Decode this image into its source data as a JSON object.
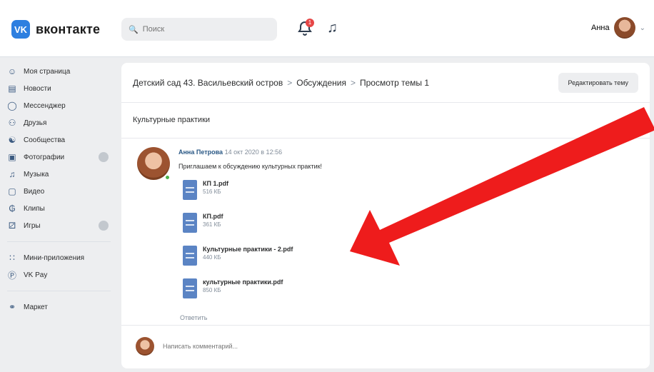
{
  "header": {
    "logo_text": "вконтакте",
    "search_placeholder": "Поиск",
    "notifications_badge": "1",
    "user_name": "Анна"
  },
  "sidebar": {
    "items": [
      {
        "label": "Моя страница",
        "icon": "user-circle-icon"
      },
      {
        "label": "Новости",
        "icon": "news-icon"
      },
      {
        "label": "Мессенджер",
        "icon": "chat-icon"
      },
      {
        "label": "Друзья",
        "icon": "friends-icon"
      },
      {
        "label": "Сообщества",
        "icon": "communities-icon"
      },
      {
        "label": "Фотографии",
        "icon": "photo-icon"
      },
      {
        "label": "Музыка",
        "icon": "music-icon"
      },
      {
        "label": "Видео",
        "icon": "video-icon"
      },
      {
        "label": "Клипы",
        "icon": "clips-icon"
      },
      {
        "label": "Игры",
        "icon": "games-icon"
      }
    ],
    "extra_items": [
      {
        "label": "Мини-приложения",
        "icon": "apps-icon"
      },
      {
        "label": "VK Pay",
        "icon": "vkpay-icon"
      },
      {
        "label": "Маркет",
        "icon": "market-icon"
      }
    ]
  },
  "breadcrumb": {
    "group": "Детский сад 43. Васильевский остров",
    "section": "Обсуждения",
    "page": "Просмотр темы 1",
    "separator": ">"
  },
  "edit_button": "Редактировать тему",
  "topic_title": "Культурные практики",
  "post": {
    "author": "Анна Петрова",
    "date": "14 окт 2020 в 12:56",
    "text": "Приглашаем к обсуждению культурных практик!",
    "reply_label": "Ответить",
    "attachments": [
      {
        "name": "КП 1.pdf",
        "size": "516 КБ"
      },
      {
        "name": "КП.pdf",
        "size": "361 КБ"
      },
      {
        "name": "Культурные практики - 2.pdf",
        "size": "440 КБ"
      },
      {
        "name": "культурные практики.pdf",
        "size": "850 КБ"
      }
    ]
  },
  "comment_placeholder": "Написать комментарий...",
  "colors": {
    "accent": "#2d7fe0",
    "arrow": "#ee1c1c",
    "background": "#edeef0"
  }
}
